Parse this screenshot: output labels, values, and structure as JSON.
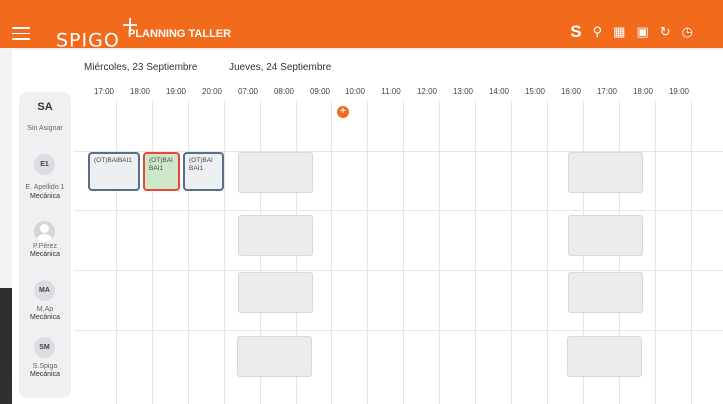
{
  "header": {
    "logo_text": "SPIGO",
    "logo_mark": "+",
    "title": "PLANNING TALLER",
    "icons": [
      "menu-icon",
      "spigo-s-icon",
      "search-icon",
      "calendar-icon",
      "calendar-week-icon",
      "refresh-icon",
      "clock-icon"
    ],
    "accent_color": "#f26b1d"
  },
  "days": [
    {
      "label": "Miércoles, 23 Septiembre"
    },
    {
      "label": "Jueves, 24 Septiembre"
    }
  ],
  "hours": [
    "17:00",
    "18:00",
    "19:00",
    "20:00",
    "07:00",
    "08:00",
    "09:00",
    "10:00",
    "11:00",
    "12:00",
    "13:00",
    "14:00",
    "15:00",
    "16:00",
    "17:00",
    "18:00",
    "19:00"
  ],
  "unassigned": {
    "short": "SA",
    "label": "Sin Asignar"
  },
  "employees": [
    {
      "initials": "E1",
      "name": "E. Apellido 1",
      "role": "Mecánica",
      "photo": false
    },
    {
      "initials": "",
      "name": "P.Pérez",
      "role": "Mecánica",
      "photo": true
    },
    {
      "initials": "MA",
      "name": "M.Ap",
      "role": "Mecánica",
      "photo": false
    },
    {
      "initials": "SM",
      "name": "S.Spiga",
      "role": "Mecánica",
      "photo": false
    }
  ],
  "jobs": [
    {
      "text": "(OT)BAIBAI1",
      "state": "normal"
    },
    {
      "text": "(OT)BAI BAI1",
      "state": "selected"
    },
    {
      "text": "(OT)BAI BAI1",
      "state": "normal"
    }
  ],
  "add_label": "+"
}
